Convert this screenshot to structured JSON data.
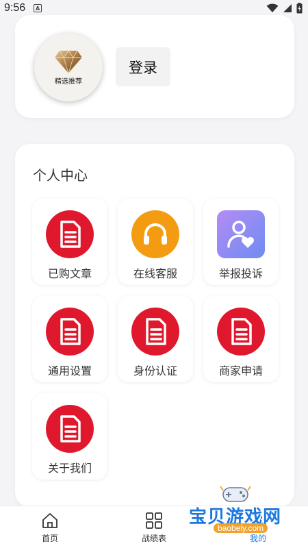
{
  "status_bar": {
    "time": "9:56",
    "notification_letter": "A"
  },
  "profile": {
    "avatar_caption": "精选推荐",
    "login_label": "登录"
  },
  "personal_center": {
    "title": "个人中心",
    "items": [
      {
        "label": "已购文章",
        "icon": "document-icon",
        "color": "#e0182d"
      },
      {
        "label": "在线客服",
        "icon": "headphones-icon",
        "color": "#f39c12"
      },
      {
        "label": "举报投诉",
        "icon": "user-heart-icon",
        "color": "#8d79f0"
      },
      {
        "label": "通用设置",
        "icon": "document-icon",
        "color": "#e0182d"
      },
      {
        "label": "身份认证",
        "icon": "document-icon",
        "color": "#e0182d"
      },
      {
        "label": "商家申请",
        "icon": "document-icon",
        "color": "#e0182d"
      },
      {
        "label": "关于我们",
        "icon": "document-icon",
        "color": "#e0182d"
      }
    ]
  },
  "bottom_nav": {
    "items": [
      {
        "label": "首页",
        "icon": "home-icon"
      },
      {
        "label": "战绩表",
        "icon": "grid-icon"
      },
      {
        "label": "我的",
        "icon": "user-icon",
        "active": true
      }
    ]
  },
  "watermark": {
    "text": "宝贝游戏网",
    "url": "baobeiy.com"
  }
}
